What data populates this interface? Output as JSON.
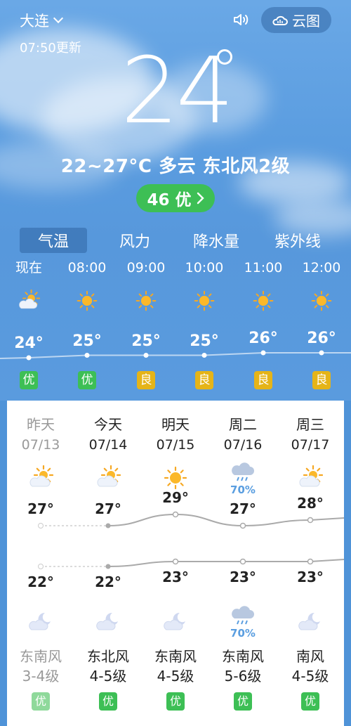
{
  "header": {
    "city": "大连",
    "update_time": "07:50更新",
    "cloud_map_label": "云图"
  },
  "current": {
    "temperature": "24",
    "summary": "22~27°C 多云 东北风2级",
    "aqi_label": "46 优"
  },
  "tabs": [
    {
      "label": "气温",
      "active": true
    },
    {
      "label": "风力",
      "active": false
    },
    {
      "label": "降水量",
      "active": false
    },
    {
      "label": "紫外线",
      "active": false
    }
  ],
  "hourly": [
    {
      "time": "现在",
      "icon": "partly-cloudy-icon",
      "temp": "24°",
      "temp_value": 24,
      "aqi": "优",
      "aqi_color": "#3dbf55"
    },
    {
      "time": "08:00",
      "icon": "sun-icon",
      "temp": "25°",
      "temp_value": 25,
      "aqi": "优",
      "aqi_color": "#3dbf55"
    },
    {
      "time": "09:00",
      "icon": "sun-icon",
      "temp": "25°",
      "temp_value": 25,
      "aqi": "良",
      "aqi_color": "#e5b418"
    },
    {
      "time": "10:00",
      "icon": "sun-icon",
      "temp": "25°",
      "temp_value": 25,
      "aqi": "良",
      "aqi_color": "#e5b418"
    },
    {
      "time": "11:00",
      "icon": "sun-icon",
      "temp": "26°",
      "temp_value": 26,
      "aqi": "良",
      "aqi_color": "#e5b418"
    },
    {
      "time": "12:00",
      "icon": "sun-icon",
      "temp": "26°",
      "temp_value": 26,
      "aqi": "良",
      "aqi_color": "#e5b418"
    }
  ],
  "daily": [
    {
      "name": "昨天",
      "date": "07/13",
      "day_icon": "partly-cloudy-icon",
      "day_pop": "",
      "high": "27°",
      "high_value": 27,
      "low": "22°",
      "low_value": 22,
      "night_icon": "moon-cloud-icon",
      "night_pop": "",
      "wind_dir": "东南风",
      "wind_level": "3-4级",
      "aqi": "优",
      "past": true
    },
    {
      "name": "今天",
      "date": "07/14",
      "day_icon": "partly-cloudy-icon",
      "day_pop": "",
      "high": "27°",
      "high_value": 27,
      "low": "22°",
      "low_value": 22,
      "night_icon": "moon-cloud-icon",
      "night_pop": "",
      "wind_dir": "东北风",
      "wind_level": "4-5级",
      "aqi": "优",
      "past": false
    },
    {
      "name": "明天",
      "date": "07/15",
      "day_icon": "sun-icon",
      "day_pop": "",
      "high": "29°",
      "high_value": 29,
      "low": "23°",
      "low_value": 23,
      "night_icon": "moon-cloud-icon",
      "night_pop": "",
      "wind_dir": "东南风",
      "wind_level": "4-5级",
      "aqi": "优",
      "past": false
    },
    {
      "name": "周二",
      "date": "07/16",
      "day_icon": "rain-cloud-icon",
      "day_pop": "70%",
      "high": "27°",
      "high_value": 27,
      "low": "23°",
      "low_value": 23,
      "night_icon": "rain-cloud-icon",
      "night_pop": "70%",
      "wind_dir": "东南风",
      "wind_level": "5-6级",
      "aqi": "优",
      "past": false
    },
    {
      "name": "周三",
      "date": "07/17",
      "day_icon": "partly-cloudy-icon",
      "day_pop": "",
      "high": "28°",
      "high_value": 28,
      "low": "23°",
      "low_value": 23,
      "night_icon": "moon-cloud-icon",
      "night_pop": "",
      "wind_dir": "南风",
      "wind_level": "4-5级",
      "aqi": "优",
      "past": false
    }
  ],
  "colors": {
    "aqi_good": "#3dbf55",
    "aqi_moderate": "#e5b418",
    "aqi_good_past": "#8fd99b",
    "rain_text": "#5a9ee0"
  }
}
